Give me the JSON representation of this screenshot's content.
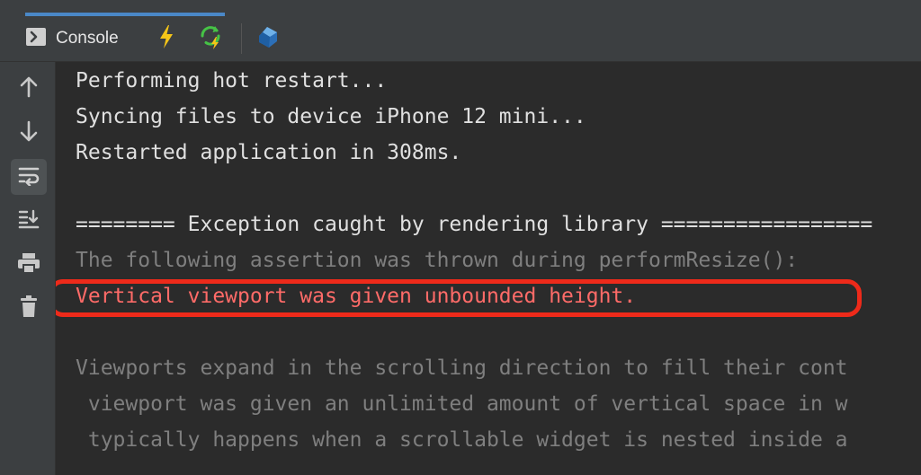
{
  "toolbar": {
    "console_label": "Console",
    "icons": [
      "console-icon",
      "lightning-icon",
      "hot-restart-icon",
      "dart-devtools-icon"
    ]
  },
  "sidebar": {
    "icons": [
      "arrow-up-icon",
      "arrow-down-icon",
      "soft-wrap-icon",
      "scroll-to-end-icon",
      "print-icon",
      "trash-icon"
    ]
  },
  "console": {
    "lines": [
      "Performing hot restart...",
      "Syncing files to device iPhone 12 mini...",
      "Restarted application in 308ms.",
      "",
      "======== Exception caught by rendering library =================",
      "The following assertion was thrown during performResize():",
      "Vertical viewport was given unbounded height.",
      "",
      "Viewports expand in the scrolling direction to fill their cont",
      " viewport was given an unlimited amount of vertical space in w",
      " typically happens when a scrollable widget is nested inside a"
    ]
  },
  "colors": {
    "background": "#2b2b2b",
    "panel": "#3c3f41",
    "text": "#e0e0e0",
    "dim_text": "#7f7f7f",
    "error_text": "#ff6b68",
    "highlight_border": "#ee2a1a",
    "lightning": "#f5c518",
    "restart": "#46c346",
    "accent": "#4a88c7"
  }
}
